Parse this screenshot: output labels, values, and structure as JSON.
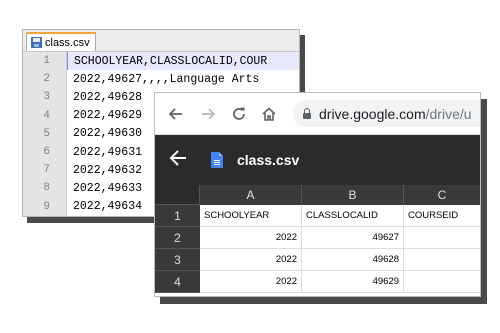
{
  "editor": {
    "tab_label": "class.csv",
    "lines": [
      {
        "num": "1",
        "text": "SCHOOLYEAR,CLASSLOCALID,COUR"
      },
      {
        "num": "2",
        "text": "2022,49627,,,,Language Arts"
      },
      {
        "num": "3",
        "text": "2022,49628"
      },
      {
        "num": "4",
        "text": "2022,49629"
      },
      {
        "num": "5",
        "text": "2022,49630"
      },
      {
        "num": "6",
        "text": "2022,49631"
      },
      {
        "num": "7",
        "text": "2022,49632"
      },
      {
        "num": "8",
        "text": "2022,49633"
      },
      {
        "num": "9",
        "text": "2022,49634"
      }
    ]
  },
  "browser": {
    "back_icon": "arrow-left-icon",
    "forward_icon": "arrow-right-icon",
    "reload_icon": "reload-icon",
    "home_icon": "home-icon",
    "url_host": "drive.google.com",
    "url_path": "/drive/u"
  },
  "viewer": {
    "file_title": "class.csv",
    "columns": [
      "A",
      "B",
      "C"
    ],
    "rows": [
      {
        "num": "1",
        "cells": [
          "SCHOOLYEAR",
          "CLASSLOCALID",
          "COURSEID"
        ]
      },
      {
        "num": "2",
        "cells": [
          "2022",
          "49627",
          ""
        ]
      },
      {
        "num": "3",
        "cells": [
          "2022",
          "49628",
          ""
        ]
      },
      {
        "num": "4",
        "cells": [
          "2022",
          "49629",
          ""
        ]
      }
    ]
  }
}
